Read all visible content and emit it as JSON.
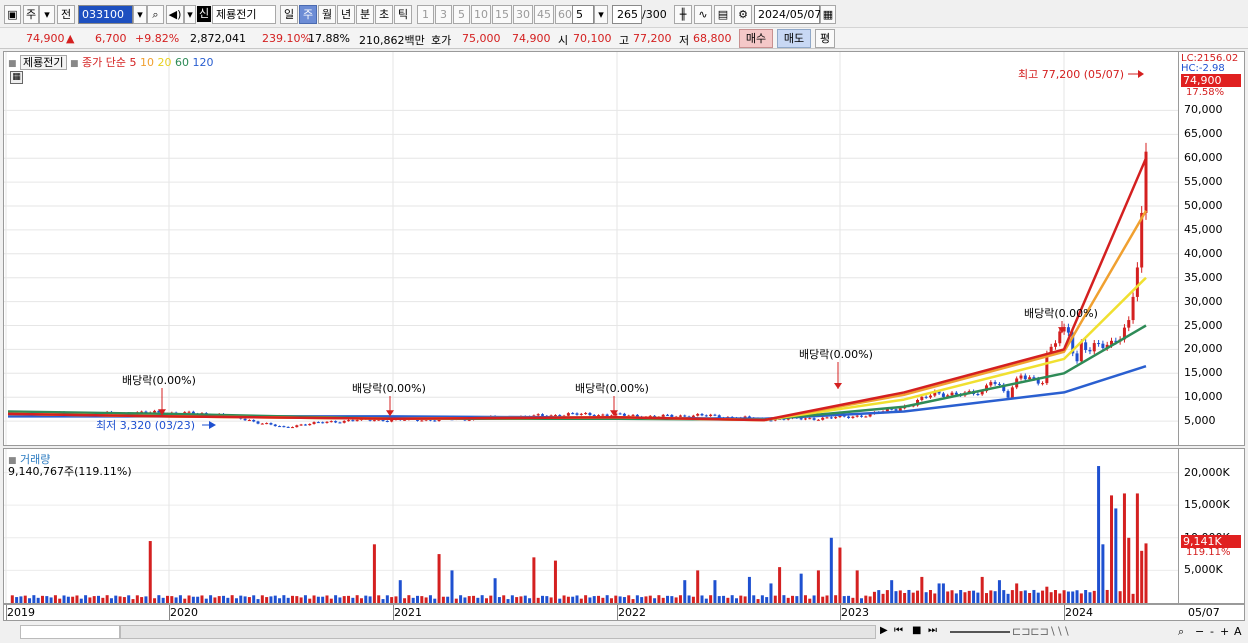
{
  "toolbar": {
    "market_type": "주",
    "prev_label": "전",
    "stock_code": "033100",
    "stock_prefix": "신",
    "stock_name": "제룡전기",
    "period_buttons": [
      "일",
      "주",
      "월",
      "년",
      "분",
      "초",
      "틱"
    ],
    "period_selected": "주",
    "interval_buttons": [
      "1",
      "3",
      "5",
      "10",
      "15",
      "30",
      "45",
      "60"
    ],
    "interval_value": "5",
    "count_display": "265",
    "count_total": "/300",
    "date_value": "2024/05/07"
  },
  "quote": {
    "price": "74,900",
    "arrow": "▲",
    "change": "6,700",
    "change_pct": "+9.82%",
    "volume": "2,872,041",
    "vol_ratio": "239.10%",
    "turnover": "17.88%",
    "amount": "210,862백만",
    "ask_label": "호가",
    "ask_sell": "75,000",
    "ask_buy": "74,900",
    "open_label": "시",
    "open": "70,100",
    "high_label": "고",
    "high": "77,200",
    "low_label": "저",
    "low": "68,800",
    "buy_button": "매수",
    "sell_button": "매도",
    "eval_button": "평"
  },
  "legend": {
    "stock": "제룡전기",
    "ma_title": "종가 단순",
    "ma_periods": [
      {
        "label": "5",
        "color": "#d42020"
      },
      {
        "label": "10",
        "color": "#f0a030"
      },
      {
        "label": "20",
        "color": "#f0e030"
      },
      {
        "label": "60",
        "color": "#2e8b57"
      },
      {
        "label": "120",
        "color": "#2a5fd0"
      }
    ]
  },
  "annotations": {
    "high_note": "최고 77,200 (05/07)",
    "low_note": "최저 3,320 (03/23)",
    "dividend_notes": [
      "배당락(0.00%)",
      "배당락(0.00%)",
      "배당락(0.00%)",
      "배당락(0.00%)",
      "배당락(0.00%)"
    ]
  },
  "right_axis": {
    "lc": "LC:2156.02",
    "hc": "HC:-2.98",
    "current_price": "74,900",
    "current_pct": "17.58%",
    "ticks": [
      "70,000",
      "65,000",
      "60,000",
      "55,000",
      "50,000",
      "45,000",
      "40,000",
      "35,000",
      "30,000",
      "25,000",
      "20,000",
      "15,000",
      "10,000",
      "5,000"
    ]
  },
  "volume": {
    "title": "거래량",
    "value": "9,140,767주(119.11%)",
    "ticks": [
      "20,000K",
      "15,000K",
      "10,000K",
      "5,000K"
    ],
    "current": "9,141K",
    "current_pct": "119.11%"
  },
  "x_axis": {
    "years": [
      "2019",
      "2020",
      "2021",
      "2022",
      "2023",
      "2024"
    ],
    "last_label": "05/07"
  },
  "colors": {
    "up": "#d42020",
    "down": "#1e50d0",
    "accent": "#6c8cd5"
  },
  "chart_data": {
    "type": "line",
    "title": "",
    "x": [
      "2019",
      "2020",
      "2021",
      "2022",
      "2023",
      "2024",
      "05/07"
    ],
    "series": [
      {
        "name": "5",
        "values": [
          6500,
          6000,
          5500,
          5800,
          5200,
          11000,
          20000,
          60000
        ]
      },
      {
        "name": "10",
        "values": [
          6500,
          6000,
          5500,
          5800,
          5200,
          10500,
          19500,
          49000
        ]
      },
      {
        "name": "20",
        "values": [
          6500,
          6000,
          5500,
          5800,
          5200,
          9500,
          18000,
          35000
        ]
      },
      {
        "name": "60",
        "values": [
          7000,
          6500,
          5500,
          5500,
          5300,
          8000,
          15000,
          25000
        ]
      },
      {
        "name": "120",
        "values": [
          6000,
          6000,
          6000,
          5700,
          5500,
          7000,
          11000,
          16500
        ]
      }
    ],
    "ylim": [
      0,
      77200
    ],
    "last_close": 74900,
    "high": 77200,
    "low": 3320
  }
}
